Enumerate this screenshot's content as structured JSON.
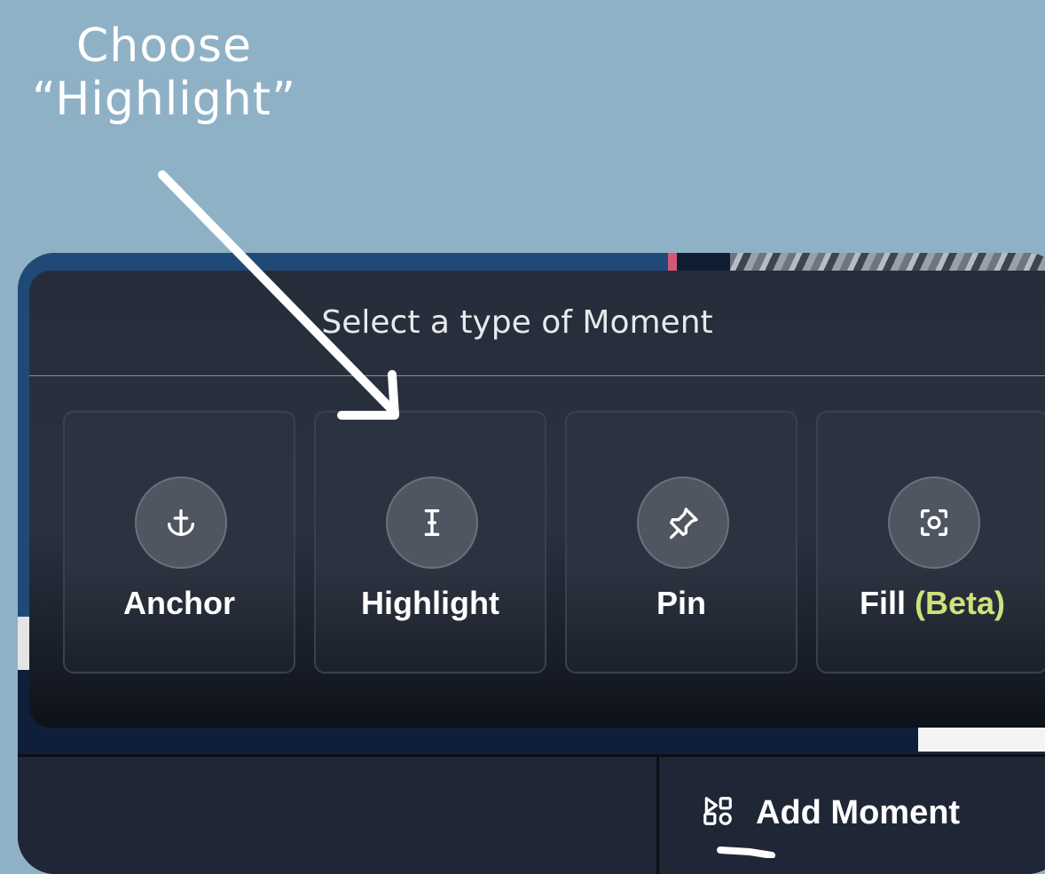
{
  "instruction": {
    "line1": "Choose",
    "line2": "“Highlight”"
  },
  "modal": {
    "title": "Select a type of Moment",
    "options": [
      {
        "label": "Anchor",
        "icon": "anchor-icon"
      },
      {
        "label": "Highlight",
        "icon": "text-cursor-icon"
      },
      {
        "label": "Pin",
        "icon": "pin-icon"
      },
      {
        "label": "Fill",
        "suffix": "(Beta)",
        "icon": "focus-icon"
      }
    ]
  },
  "toolbar": {
    "add_moment_label": "Add Moment",
    "add_moment_icon": "shapes-icon"
  },
  "colors": {
    "page_background": "#8fb1c6",
    "modal_background": "#262d3a",
    "beta_accent": "#cfe27a",
    "annotation": "#ffffff"
  }
}
